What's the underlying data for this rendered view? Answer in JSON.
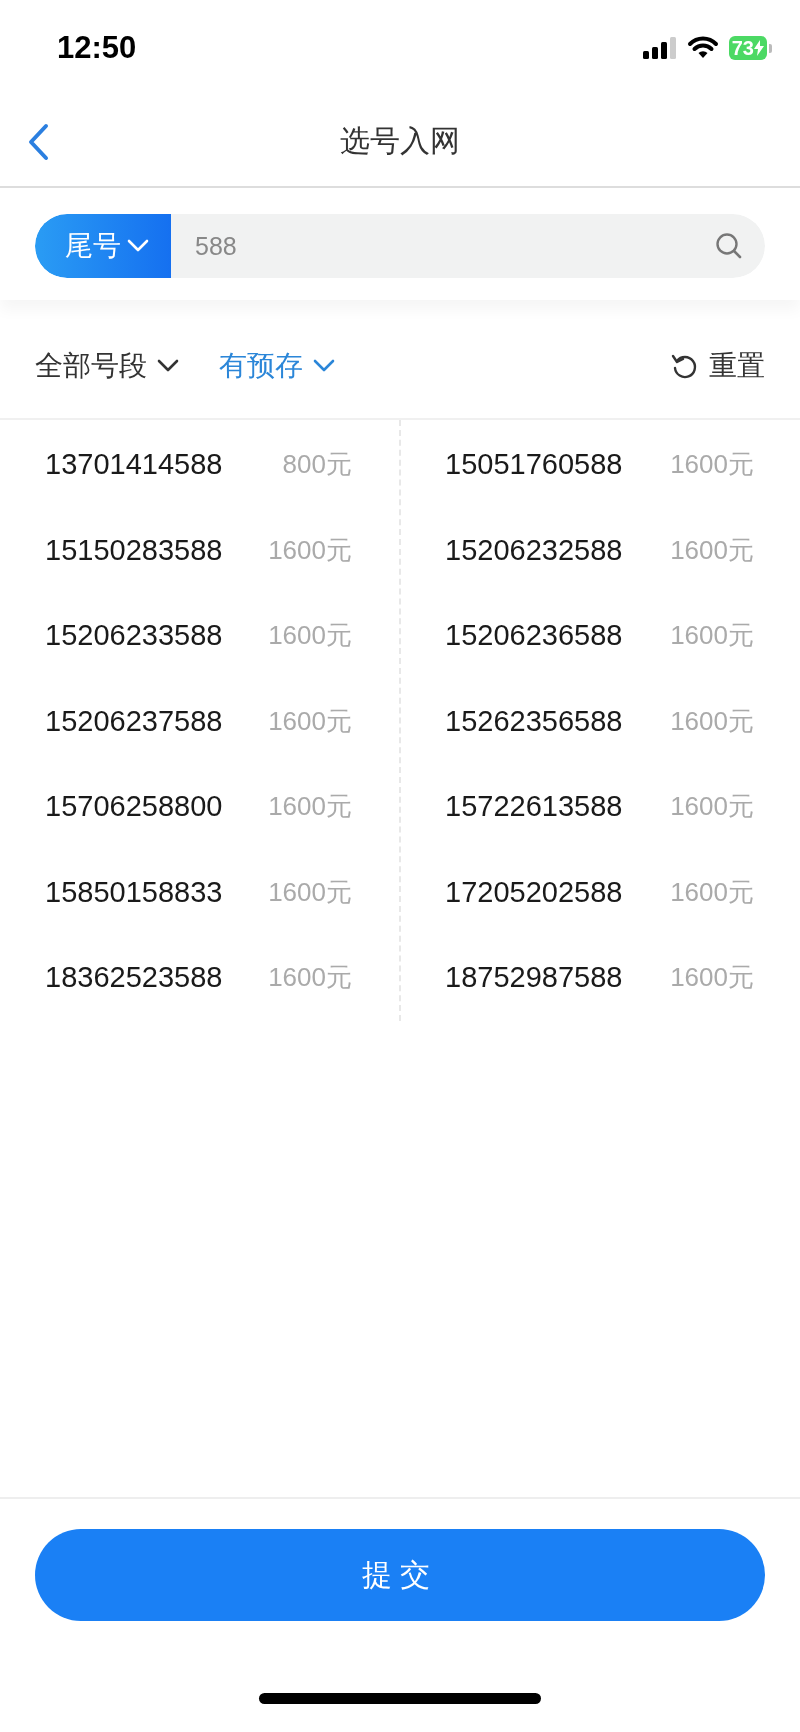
{
  "status_bar": {
    "time": "12:50",
    "battery": "73"
  },
  "nav": {
    "title": "选号入网"
  },
  "search": {
    "mode": "尾号",
    "value": "588"
  },
  "filters": [
    {
      "label": "全部号段",
      "active": false
    },
    {
      "label": "有预存",
      "active": true
    }
  ],
  "reset": "重置",
  "numbers": [
    {
      "number": "13701414588",
      "price": "800元"
    },
    {
      "number": "15051760588",
      "price": "1600元"
    },
    {
      "number": "15150283588",
      "price": "1600元"
    },
    {
      "number": "15206232588",
      "price": "1600元"
    },
    {
      "number": "15206233588",
      "price": "1600元"
    },
    {
      "number": "15206236588",
      "price": "1600元"
    },
    {
      "number": "15206237588",
      "price": "1600元"
    },
    {
      "number": "15262356588",
      "price": "1600元"
    },
    {
      "number": "15706258800",
      "price": "1600元"
    },
    {
      "number": "15722613588",
      "price": "1600元"
    },
    {
      "number": "15850158833",
      "price": "1600元"
    },
    {
      "number": "17205202588",
      "price": "1600元"
    },
    {
      "number": "18362523588",
      "price": "1600元"
    },
    {
      "number": "18752987588",
      "price": "1600元"
    }
  ],
  "submit": "提交"
}
